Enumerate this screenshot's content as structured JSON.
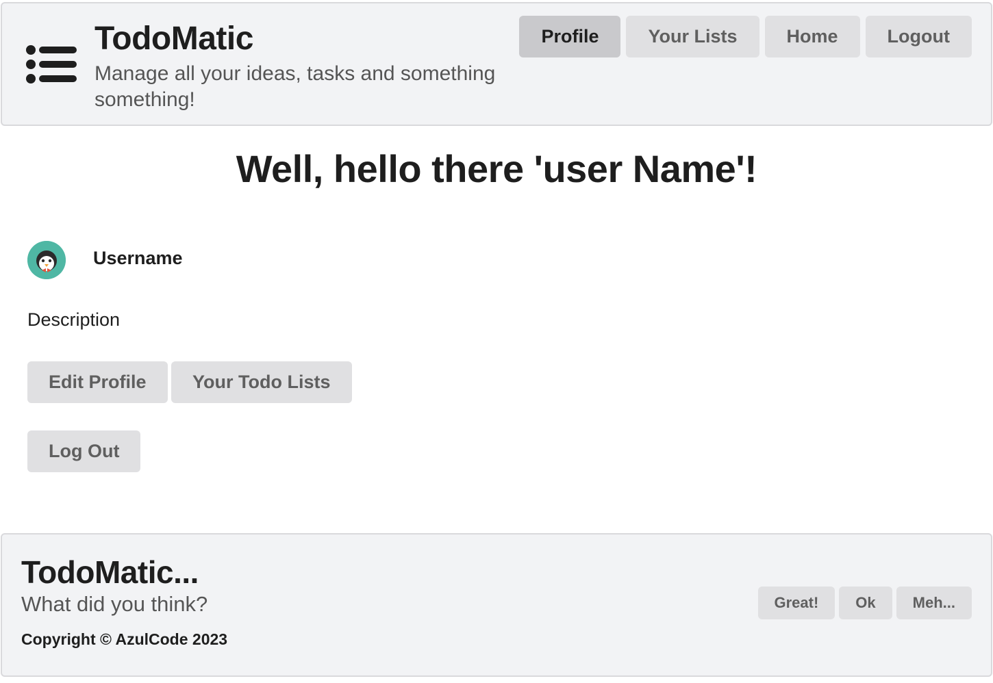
{
  "header": {
    "title": "TodoMatic",
    "subtitle": "Manage all your ideas, tasks and something something!",
    "menu_icon": "list-icon",
    "nav": [
      {
        "label": "Profile",
        "active": true
      },
      {
        "label": "Your Lists",
        "active": false
      },
      {
        "label": "Home",
        "active": false
      },
      {
        "label": "Logout",
        "active": false
      }
    ]
  },
  "main": {
    "greeting": "Well, hello there 'user Name'!",
    "avatar_icon": "penguin-avatar",
    "username": "Username",
    "description": "Description",
    "buttons": {
      "edit_profile": "Edit Profile",
      "todo_lists": "Your Todo Lists",
      "log_out": "Log Out"
    }
  },
  "footer": {
    "title": "TodoMatic...",
    "question": "What did you think?",
    "copyright": "Copyright © AzulCode 2023",
    "feedback": [
      "Great!",
      "Ok",
      "Meh..."
    ]
  },
  "colors": {
    "panel_bg": "#f2f3f5",
    "button_bg": "#e0e0e2",
    "button_active_bg": "#c9c9cc",
    "avatar_bg": "#4fb7a4"
  }
}
